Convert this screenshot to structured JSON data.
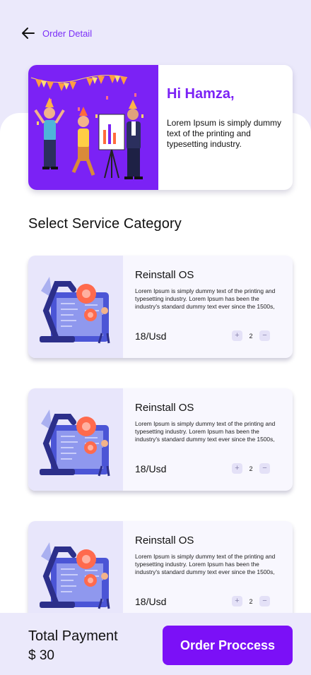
{
  "header": {
    "title": "Order Detail",
    "back_icon": "arrow-left-icon"
  },
  "promo": {
    "greeting": "Hi Hamza,",
    "body": "Lorem Ipsum is simply dummy text of the printing and typesetting industry.",
    "image": "party-celebration-illustration",
    "accent": "#7b22f5"
  },
  "section_title": "Select Service Category",
  "services": [
    {
      "title": "Reinstall OS",
      "desc": "Lorem Ipsum is simply dummy text of the printing and typesetting industry. Lorem Ipsum has been the industry's standard dummy text ever since the 1500s,",
      "price": "18/Usd",
      "qty": "2",
      "plus": "+",
      "minus": "−"
    },
    {
      "title": "Reinstall OS",
      "desc": "Lorem Ipsum is simply dummy text of the printing and typesetting industry. Lorem Ipsum has been the industry's standard dummy text ever since the 1500s,",
      "price": "18/Usd",
      "qty": "2",
      "plus": "+",
      "minus": "−"
    },
    {
      "title": "Reinstall OS",
      "desc": "Lorem Ipsum is simply dummy text of the printing and typesetting industry. Lorem Ipsum has been the industry's standard dummy text ever since the 1500s,",
      "price": "18/Usd",
      "qty": "2",
      "plus": "+",
      "minus": "−"
    }
  ],
  "footer": {
    "total_label": "Total Payment",
    "total_value": "$ 30",
    "button_label": "Order Proccess",
    "button_color": "#7b10f7"
  }
}
